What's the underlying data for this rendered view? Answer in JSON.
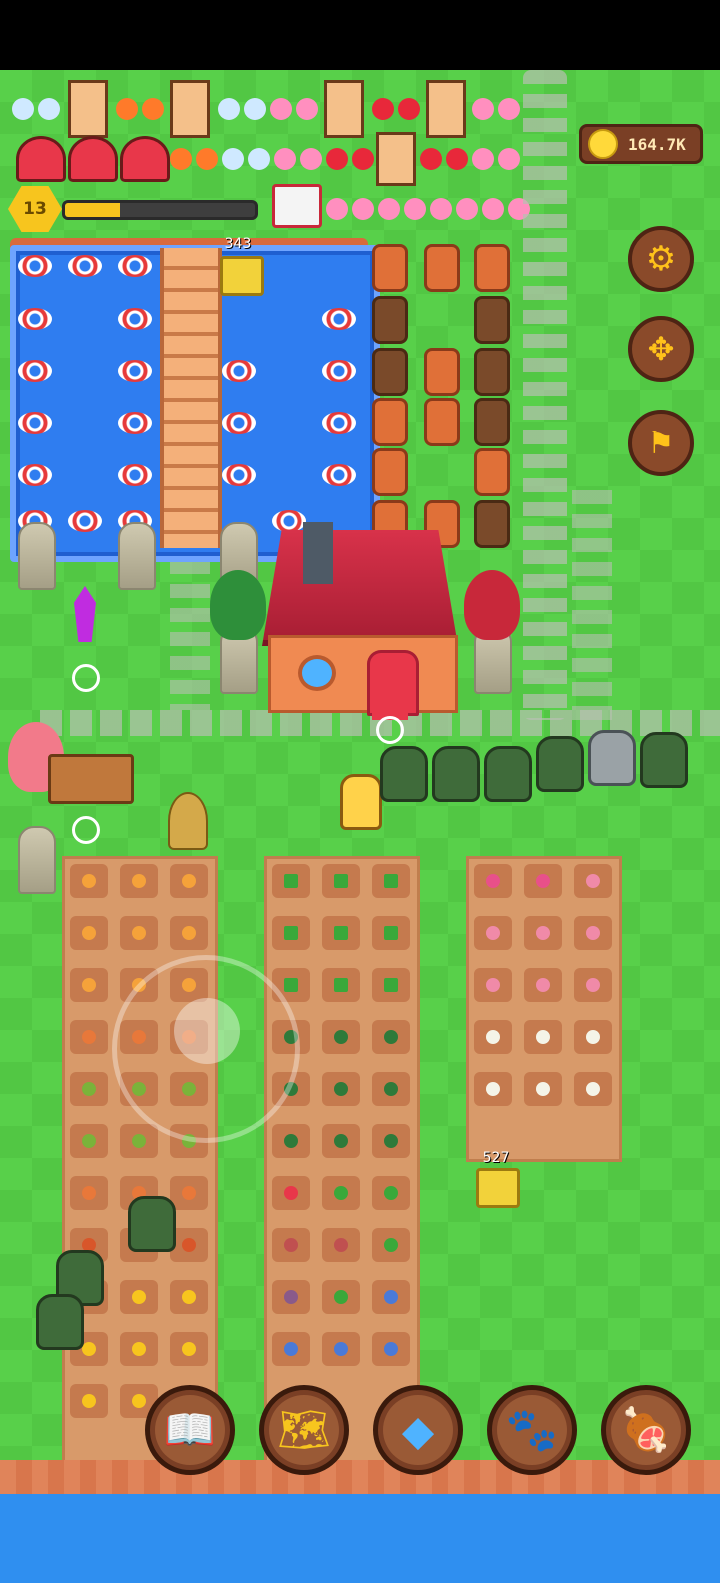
{
  "hud": {
    "coins": "164.7K",
    "level": "13",
    "xp_progress": 0.29
  },
  "world": {
    "chest_labels": [
      "343",
      "527"
    ]
  },
  "side_buttons": [
    {
      "name": "settings",
      "icon": "gear-icon"
    },
    {
      "name": "move",
      "icon": "move-arrows-icon"
    },
    {
      "name": "flag",
      "icon": "flag-icon"
    }
  ],
  "dock": [
    {
      "name": "book",
      "icon": "book-icon"
    },
    {
      "name": "map",
      "icon": "map-icon"
    },
    {
      "name": "shop",
      "icon": "gem-coin-icon"
    },
    {
      "name": "pets",
      "icon": "paw-icon"
    },
    {
      "name": "ham",
      "icon": "ham-icon"
    }
  ],
  "colors": {
    "grass": "#58d04a",
    "water": "#2f7df0",
    "hud_brown": "#7a3f25",
    "gold": "#f7c51e"
  }
}
